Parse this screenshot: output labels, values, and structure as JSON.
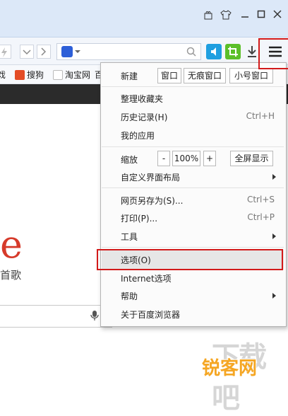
{
  "titlebar": {
    "controls": [
      "gift-icon",
      "shirt-icon",
      "minimize-icon",
      "maximize-icon",
      "close-icon"
    ]
  },
  "bookmarks": [
    {
      "label": "戏"
    },
    {
      "label": "搜狗"
    },
    {
      "label": "淘宝网"
    },
    {
      "label": "百"
    }
  ],
  "page": {
    "logo_fragment": "e",
    "text_fragment": "首歌"
  },
  "menu": {
    "new_label": "新建",
    "new_window": "窗口",
    "incognito_window": "无痕窗口",
    "small_window": "小号窗口",
    "organize_favorites": "整理收藏夹",
    "history": {
      "label": "历史记录(H)",
      "shortcut": "Ctrl+H"
    },
    "my_apps": "我的应用",
    "zoom_label": "缩放",
    "zoom_minus": "-",
    "zoom_value": "100%",
    "zoom_plus": "+",
    "fullscreen": "全屏显示",
    "customize_layout": "自定义界面布局",
    "save_as": {
      "label": "网页另存为(S)...",
      "shortcut": "Ctrl+S"
    },
    "print": {
      "label": "打印(P)...",
      "shortcut": "Ctrl+P"
    },
    "tools": "工具",
    "options": "选项(O)",
    "internet_options": "Internet选项",
    "help": "帮助",
    "about": "关于百度浏览器"
  },
  "watermark": {
    "faint": "下载吧",
    "main": "锐客网"
  },
  "colors": {
    "highlight_red": "#d21a1a",
    "titlebar_bg": "#dce8f8",
    "menu_hover": "#e6e6e6",
    "logo_red": "#d63a2a",
    "watermark_orange": "#f5a623"
  }
}
